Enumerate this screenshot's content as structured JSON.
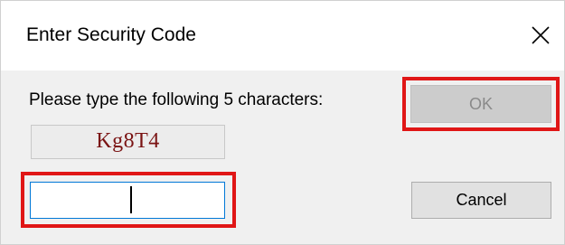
{
  "window": {
    "title": "Enter Security Code",
    "close_glyph": "close-icon"
  },
  "prompt": {
    "text": "Please type the following 5 characters:"
  },
  "captcha": {
    "code": "Kg8T4",
    "color": "#7a1313"
  },
  "input": {
    "value": "",
    "placeholder": ""
  },
  "buttons": {
    "ok_label": "OK",
    "ok_enabled": false,
    "cancel_label": "Cancel"
  },
  "highlight_color": "#e01616"
}
